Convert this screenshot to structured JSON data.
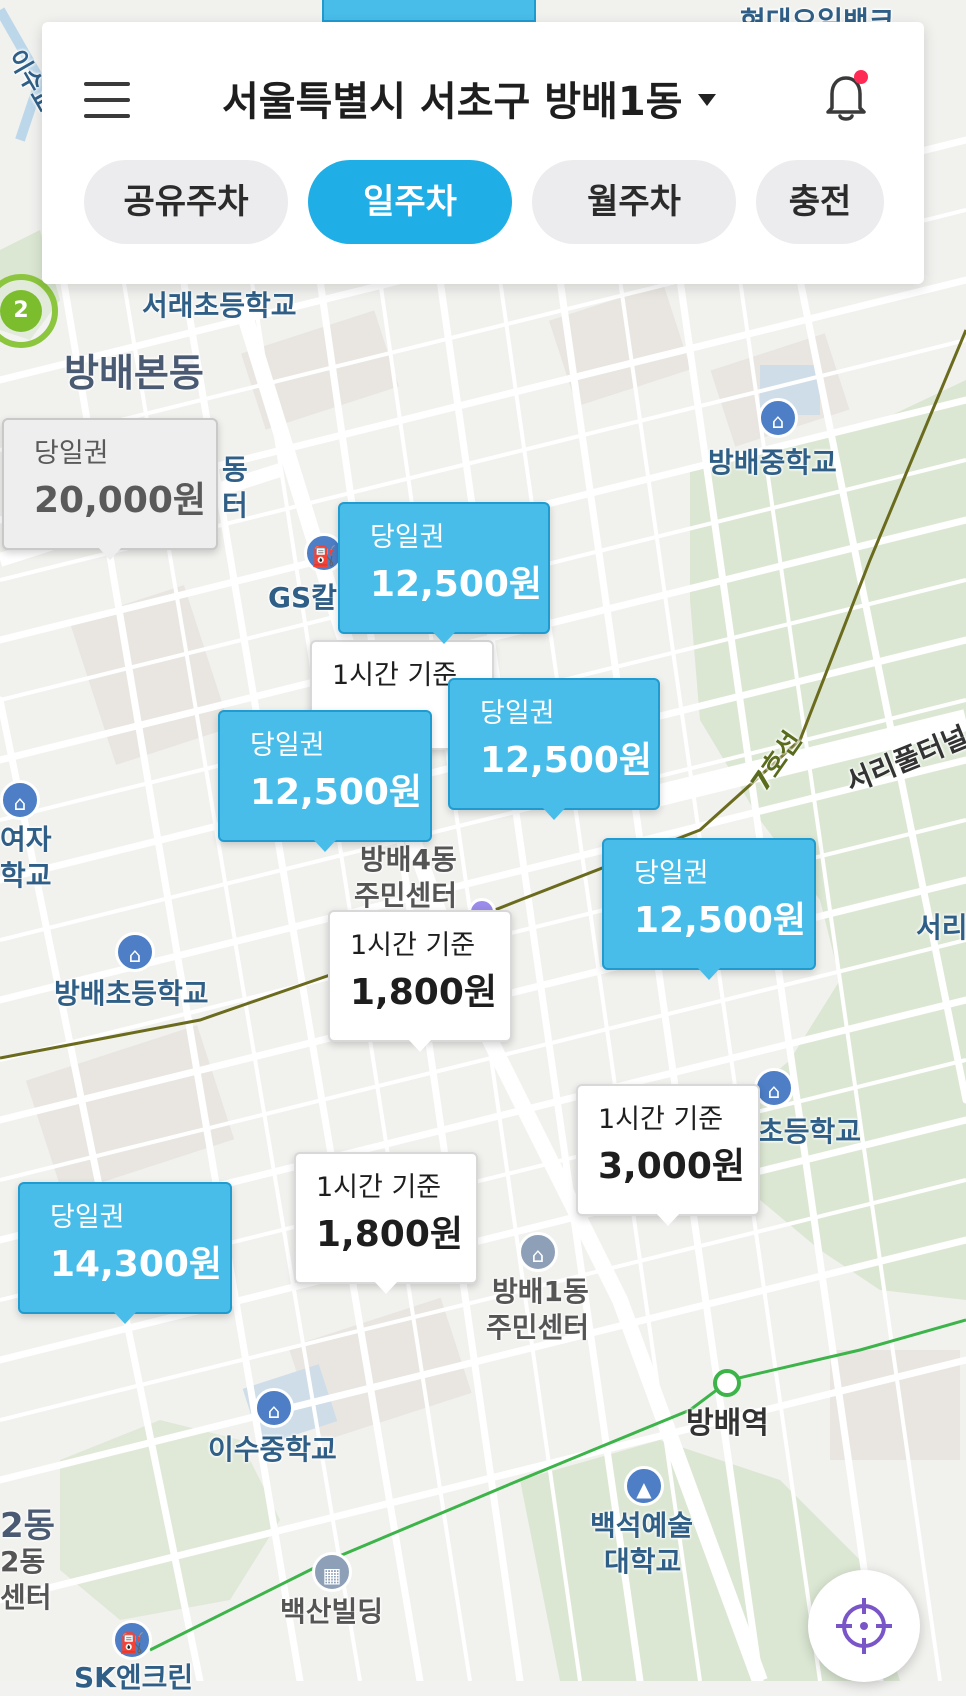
{
  "header": {
    "location": "서울특별시 서초구 방배1동",
    "tabs": [
      {
        "label": "공유주차",
        "active": false
      },
      {
        "label": "일주차",
        "active": true
      },
      {
        "label": "월주차",
        "active": false
      },
      {
        "label": "충전",
        "active": false
      }
    ]
  },
  "map": {
    "places": {
      "top_cut_1": "현대오일뱅크",
      "top_cut_2": "이수교",
      "school_seorae": "서래초등학교",
      "area_bangbaebon": "방배본동",
      "school_bangbae_middle": "방배중학교",
      "gs": "GS칼텍",
      "dong_fragment": "동",
      "ter_fragment": "터",
      "center_bangbae4_line1": "방배4동",
      "center_bangbae4_line2": "주민센터",
      "school_bangbae_elem": "방배초등학교",
      "girls_line1": "여자",
      "girls_line2": "학교",
      "seoripul": "서리풀터널",
      "seori_fragment": "서리",
      "line7": "7호선",
      "school_right": "초등학교",
      "center_bangbae1_line1": "방배1동",
      "center_bangbae1_line2": "주민센터",
      "station_bangbae": "방배역",
      "school_isu_middle": "이수중학교",
      "baekseok_line1": "백석예술",
      "baekseok_line2": "대학교",
      "baeksan": "백산빌딩",
      "sk": "SK엔크린",
      "left_dong": "2동",
      "left_dong_small": "2동",
      "left_center": "센터"
    },
    "cluster_count": "2"
  },
  "pins": [
    {
      "top": "당일권",
      "price": "20,000원",
      "style": "grey"
    },
    {
      "top": "당일권",
      "price": "12,500원",
      "style": "blue"
    },
    {
      "top": "1시간 기준",
      "price": "",
      "style": "white"
    },
    {
      "top": "당일권",
      "price": "12,500원",
      "style": "blue"
    },
    {
      "top": "당일권",
      "price": "12,500원",
      "style": "blue"
    },
    {
      "top": "당일권",
      "price": "12,500원",
      "style": "blue"
    },
    {
      "top": "1시간 기준",
      "price": "1,800원",
      "style": "white"
    },
    {
      "top": "1시간 기준",
      "price": "3,000원",
      "style": "white"
    },
    {
      "top": "당일권",
      "price": "14,300원",
      "style": "blue"
    },
    {
      "top": "1시간 기준",
      "price": "1,800원",
      "style": "white"
    }
  ],
  "colors": {
    "accent": "#1faee6",
    "pin_blue": "#48bdea",
    "park": "#dbe7d3",
    "subway_line7": "#6b6b1e",
    "subway_line2": "#3cb44a",
    "current_location": "#9b8bea",
    "notification_dot": "#ff2b55"
  },
  "icons": {
    "menu": "menu-icon",
    "dropdown": "caret-down-icon",
    "notification": "bell-icon",
    "locate": "crosshair-icon"
  }
}
